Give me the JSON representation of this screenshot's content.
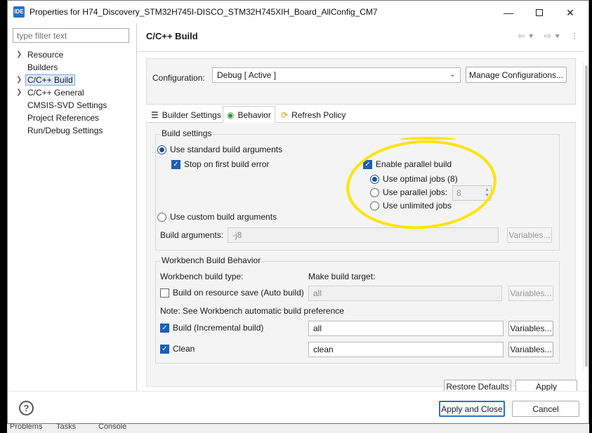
{
  "window": {
    "icon_text": "IDE",
    "title": "Properties for H74_Discovery_STM32H745I-DISCO_STM32H745XIH_Board_AllConfig_CM7",
    "minimize_icon": "minimize-icon",
    "maximize_icon": "maximize-icon",
    "close_icon": "close-icon"
  },
  "sidebar": {
    "filter_placeholder": "type filter text",
    "items": [
      {
        "label": "Resource",
        "expandable": true
      },
      {
        "label": "Builders",
        "expandable": false
      },
      {
        "label": "C/C++ Build",
        "expandable": true,
        "selected": true
      },
      {
        "label": "C/C++ General",
        "expandable": true
      },
      {
        "label": "CMSIS-SVD Settings",
        "expandable": false
      },
      {
        "label": "Project References",
        "expandable": false
      },
      {
        "label": "Run/Debug Settings",
        "expandable": false
      }
    ]
  },
  "page": {
    "title": "C/C++ Build"
  },
  "configuration": {
    "label": "Configuration:",
    "value": "Debug  [ Active ]",
    "manage_label": "Manage Configurations..."
  },
  "tabs": [
    {
      "label": "Builder Settings",
      "icon": "builder-settings-icon",
      "active": false
    },
    {
      "label": "Behavior",
      "icon": "behavior-icon",
      "active": true
    },
    {
      "label": "Refresh Policy",
      "icon": "refresh-policy-icon",
      "active": false
    }
  ],
  "build_settings": {
    "group_title": "Build settings",
    "use_standard": "Use standard build arguments",
    "stop_on_error": "Stop on first build error",
    "enable_parallel": "Enable parallel build",
    "use_optimal": "Use optimal jobs (8)",
    "use_parallel": "Use parallel jobs:",
    "parallel_jobs_value": "8",
    "use_unlimited": "Use unlimited jobs",
    "use_custom": "Use custom build arguments",
    "build_args_label": "Build arguments:",
    "build_args_value": "-j8",
    "variables_label": "Variables..."
  },
  "workbench": {
    "group_title": "Workbench Build Behavior",
    "build_type_label": "Workbench build type:",
    "make_target_label": "Make build target:",
    "auto_build": "Build on resource save (Auto build)",
    "auto_build_target": "all",
    "note": "Note: See Workbench automatic build preference",
    "incremental": "Build (Incremental build)",
    "incremental_target": "all",
    "clean": "Clean",
    "clean_target": "clean",
    "variables_label": "Variables..."
  },
  "page_buttons": {
    "restore_defaults": "Restore Defaults",
    "apply": "Apply"
  },
  "footer": {
    "help_symbol": "?",
    "apply_close": "Apply and Close",
    "cancel": "Cancel"
  },
  "bottom_strip": {
    "problems": "Problems",
    "tasks": "Tasks",
    "console": "Console"
  }
}
